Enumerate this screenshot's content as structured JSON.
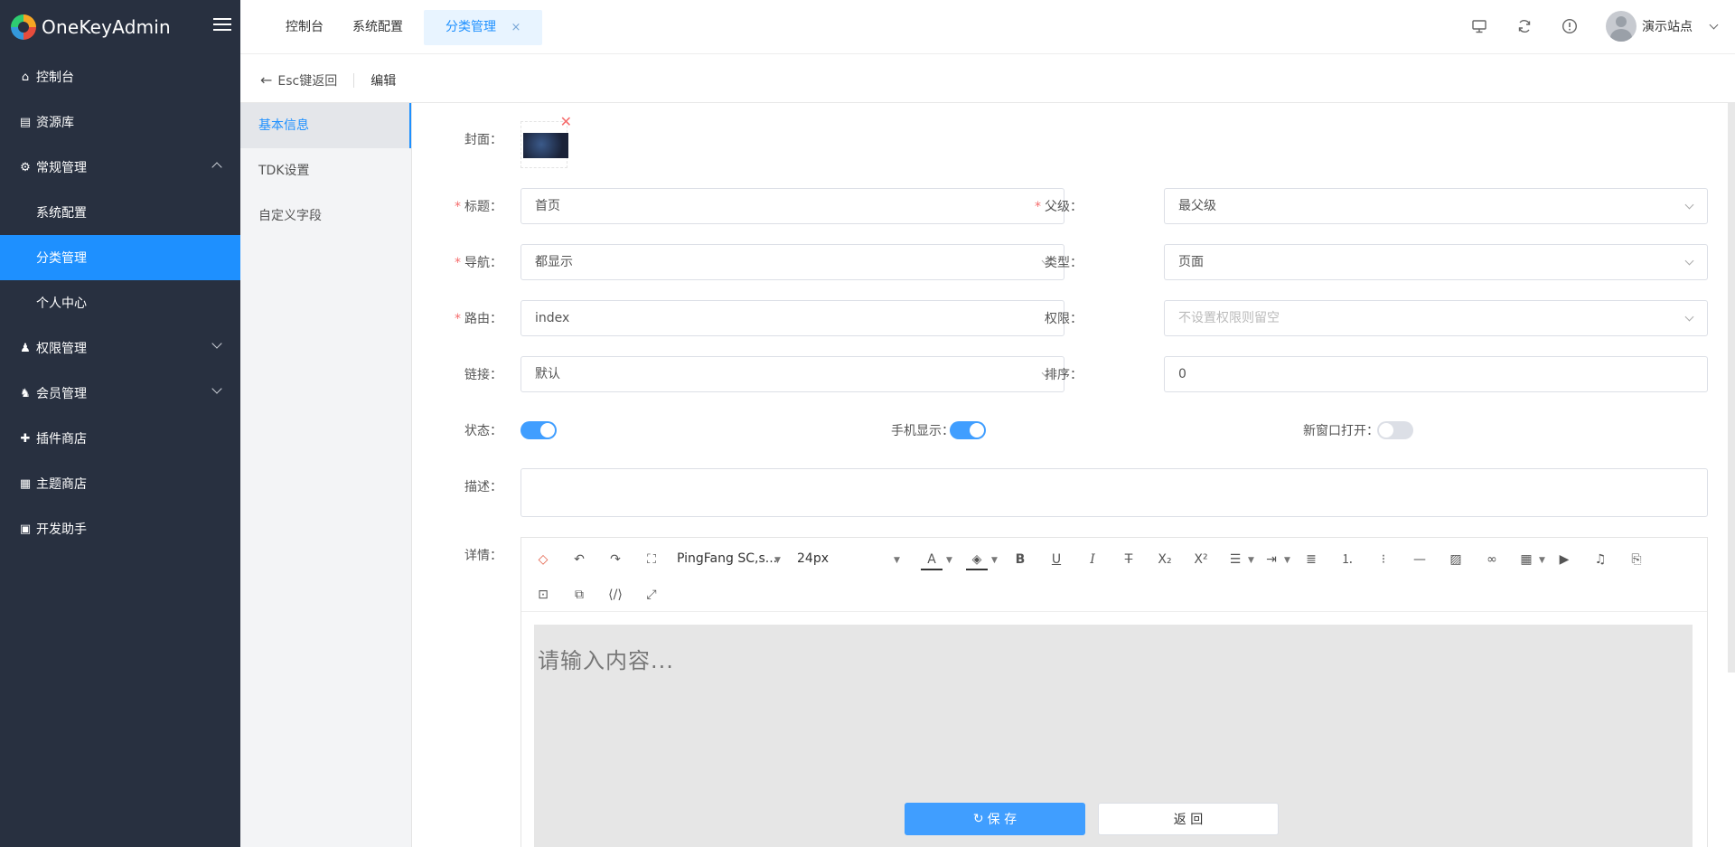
{
  "app": {
    "title": "OneKeyAdmin"
  },
  "sidebar": {
    "items": [
      {
        "label": "控制台",
        "icon": "home-icon"
      },
      {
        "label": "资源库",
        "icon": "database-icon"
      },
      {
        "label": "常规管理",
        "icon": "gear-icon",
        "expanded": true,
        "children": [
          {
            "label": "系统配置"
          },
          {
            "label": "分类管理",
            "active": true
          },
          {
            "label": "个人中心"
          }
        ]
      },
      {
        "label": "权限管理",
        "icon": "user-lock-icon",
        "expanded": false
      },
      {
        "label": "会员管理",
        "icon": "user-gear-icon",
        "expanded": false
      },
      {
        "label": "插件商店",
        "icon": "puzzle-icon"
      },
      {
        "label": "主题商店",
        "icon": "layout-icon"
      },
      {
        "label": "开发助手",
        "icon": "robot-icon"
      }
    ]
  },
  "topbar": {
    "tabs": [
      {
        "label": "控制台"
      },
      {
        "label": "系统配置"
      },
      {
        "label": "分类管理",
        "active": true,
        "close": "×"
      }
    ],
    "user": {
      "name": "演示站点"
    }
  },
  "breadcrumb": {
    "back_label": "Esc键返回",
    "title": "编辑"
  },
  "subnav": {
    "items": [
      {
        "label": "基本信息",
        "active": true
      },
      {
        "label": "TDK设置"
      },
      {
        "label": "自定义字段"
      }
    ]
  },
  "form": {
    "cover_label": "封面：",
    "title": {
      "label": "标题：",
      "value": "首页",
      "required": true
    },
    "parent": {
      "label": "父级：",
      "value": "最父级",
      "required": true
    },
    "nav": {
      "label": "导航：",
      "value": "都显示",
      "required": true
    },
    "type": {
      "label": "类型：",
      "value": "页面"
    },
    "route": {
      "label": "路由：",
      "value": "index",
      "required": true
    },
    "permission": {
      "label": "权限：",
      "placeholder": "不设置权限则留空"
    },
    "link": {
      "label": "链接：",
      "value": "默认"
    },
    "sort": {
      "label": "排序：",
      "value": "0"
    },
    "status": {
      "label": "状态：",
      "on": true
    },
    "mobile": {
      "label": "手机显示：",
      "on": true
    },
    "new_window": {
      "label": "新窗口打开：",
      "on": false
    },
    "description": {
      "label": "描述：",
      "value": ""
    },
    "detail": {
      "label": "详情：",
      "font_family": "PingFang SC,s...",
      "font_size": "24px",
      "placeholder": "请输入内容..."
    }
  },
  "footer": {
    "save_label": "保 存",
    "back_label": "返 回"
  },
  "colors": {
    "sidebar_bg": "#283040",
    "accent": "#1e90ff",
    "primary_btn": "#409eff",
    "required": "#f56c6c"
  }
}
